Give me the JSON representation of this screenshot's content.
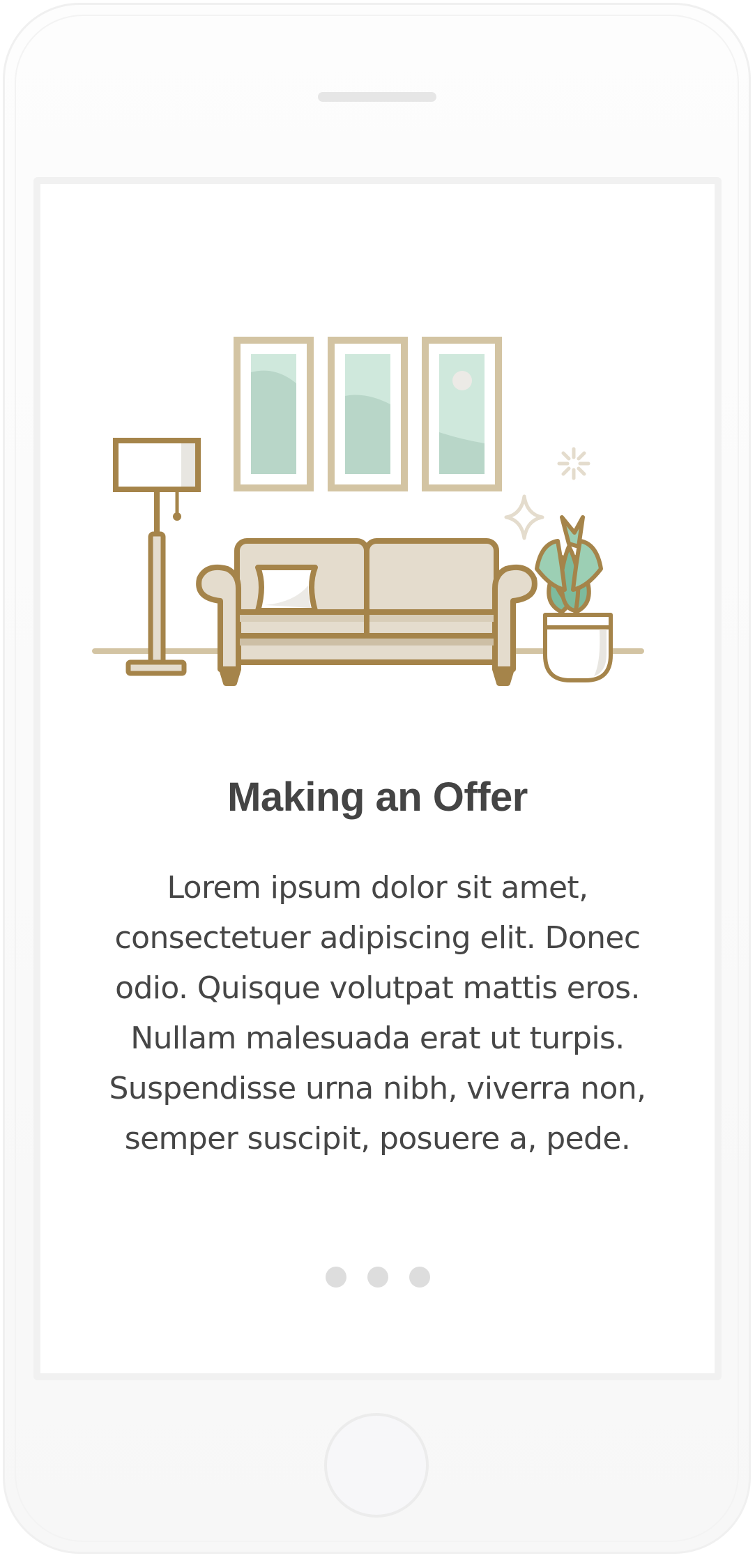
{
  "onboarding": {
    "title": "Making an Offer",
    "body": "Lorem ipsum dolor sit amet, consectetuer adipiscing elit. Donec odio. Quisque volutpat mattis eros. Nullam malesuada erat ut turpis. Suspendisse urna nibh, viverra non, semper suscipit, posuere a, pede.",
    "pagination_dots": 3
  },
  "illustration": {
    "name": "living-room-illustration",
    "elements": [
      "floor-lamp",
      "three-wall-frames",
      "sofa-with-pillow",
      "potted-plant",
      "sparkles"
    ]
  },
  "colors": {
    "outline_gold": "#a5844a",
    "frame_beige": "#d3c4a3",
    "sofa_fill": "#e4dccd",
    "glass_mint": "#cfe8dc",
    "glass_shade": "#b8d6c8",
    "leaf_green": "#7dbb9d",
    "text": "#464646",
    "dot": "#dddddd"
  }
}
